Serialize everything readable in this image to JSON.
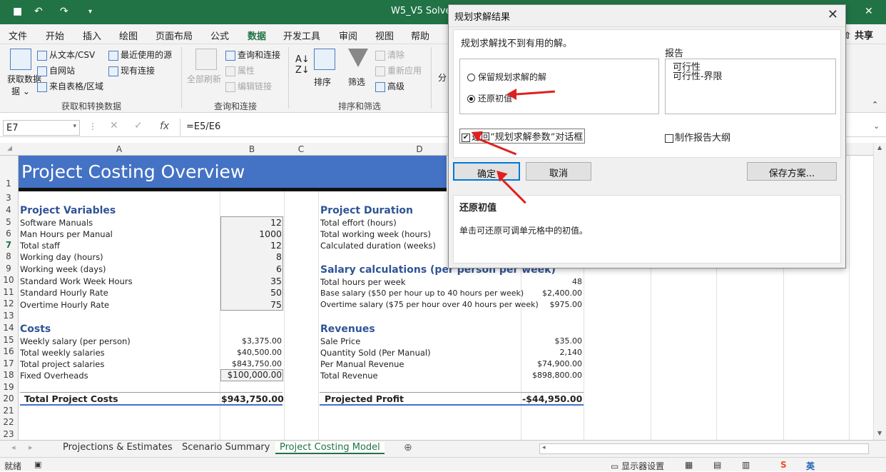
{
  "window": {
    "title": "W5_V5 Solver."
  },
  "menu": [
    "文件",
    "开始",
    "插入",
    "绘图",
    "页面布局",
    "公式",
    "数据",
    "开发工具",
    "审阅",
    "视图",
    "帮助"
  ],
  "share_label": "共享",
  "ribbon": {
    "get_data": "获取数据",
    "get_data_sub": "据",
    "from_text": "从文本/CSV",
    "from_web": "自网站",
    "from_table": "来自表格/区域",
    "recent_sources": "最近使用的源",
    "existing_conn": "现有连接",
    "group1": "获取和转换数据",
    "refresh_all": "全部刷新",
    "queries_conn": "查询和连接",
    "properties": "属性",
    "edit_links": "编辑链接",
    "group2": "查询和连接",
    "sort_az": "A↓Z",
    "sort": "排序",
    "filter": "筛选",
    "clear": "清除",
    "reapply": "重新应用",
    "advanced": "高级",
    "group3": "排序和筛选",
    "split": "分"
  },
  "formula_bar": {
    "name_box": "E7",
    "fx": "fx",
    "formula": "=E5/E6"
  },
  "columns": [
    "A",
    "B",
    "C",
    "D"
  ],
  "rows": [
    "1",
    "3",
    "4",
    "5",
    "6",
    "7",
    "8",
    "9",
    "10",
    "11",
    "12",
    "13",
    "14",
    "15",
    "16",
    "17",
    "18",
    "19",
    "20",
    "21",
    "22",
    "23"
  ],
  "sheet": {
    "title": "Project Costing Overview",
    "project_variables": {
      "header": "Project Variables",
      "items": [
        {
          "label": "Software Manuals",
          "value": "12"
        },
        {
          "label": "Man Hours per Manual",
          "value": "1000"
        },
        {
          "label": "Total staff",
          "value": "12"
        },
        {
          "label": "Working day (hours)",
          "value": "8"
        },
        {
          "label": "Working week (days)",
          "value": "6"
        },
        {
          "label": "Standard Work Week Hours",
          "value": "35"
        },
        {
          "label": "Standard Hourly Rate",
          "value": "50"
        },
        {
          "label": "Overtime Hourly Rate",
          "value": "75"
        }
      ]
    },
    "costs": {
      "header": "Costs",
      "items": [
        {
          "label": "Weekly salary (per person)",
          "value": "$3,375.00"
        },
        {
          "label": "Total weekly salaries",
          "value": "$40,500.00"
        },
        {
          "label": "Total project salaries",
          "value": "$843,750.00"
        },
        {
          "label": "Fixed Overheads",
          "value": "$100,000.00"
        }
      ],
      "total_label": "Total Project Costs",
      "total_value": "$943,750.00"
    },
    "duration": {
      "header": "Project Duration",
      "items": [
        "Total effort (hours)",
        "Total working week (hours)",
        "Calculated duration (weeks)"
      ]
    },
    "salary": {
      "header": "Salary calculations (per person per week)",
      "items": [
        {
          "label": "Total hours per week",
          "value": "48"
        },
        {
          "label": "Base salary ($50 per hour up to 40 hours per week)",
          "value": "$2,400.00"
        },
        {
          "label": "Overtime salary ($75 per hour over 40 hours per week)",
          "value": "$975.00"
        }
      ]
    },
    "revenues": {
      "header": "Revenues",
      "items": [
        {
          "label": "Sale Price",
          "value": "$35.00"
        },
        {
          "label": "Quantity Sold (Per Manual)",
          "value": "2,140"
        },
        {
          "label": "Per Manual Revenue",
          "value": "$74,900.00"
        },
        {
          "label": "Total Revenue",
          "value": "$898,800.00"
        }
      ],
      "profit_label": "Projected Profit",
      "profit_value": "-$44,950.00"
    }
  },
  "tabs": [
    "Projections & Estimates",
    "Scenario Summary",
    "Project Costing Model"
  ],
  "status": {
    "ready": "就绪",
    "display_settings": "显示器设置",
    "ime": "英"
  },
  "dialog": {
    "title": "规划求解结果",
    "message": "规划求解找不到有用的解。",
    "report_label": "报告",
    "reports": [
      "可行性",
      "可行性-界限"
    ],
    "opt_keep": "保留规划求解的解",
    "opt_restore": "还原初值",
    "return_dialog": "返回“规划求解参数”对话框",
    "outline_report": "制作报告大纲",
    "ok": "确定",
    "cancel": "取消",
    "save_scenario": "保存方案...",
    "info_title": "还原初值",
    "info_text": "单击可还原可调单元格中的初值。"
  },
  "colors": {
    "excel_green": "#217346",
    "banner_blue": "#4472c4",
    "header_blue": "#2f5496",
    "arrow_red": "#e02020"
  }
}
